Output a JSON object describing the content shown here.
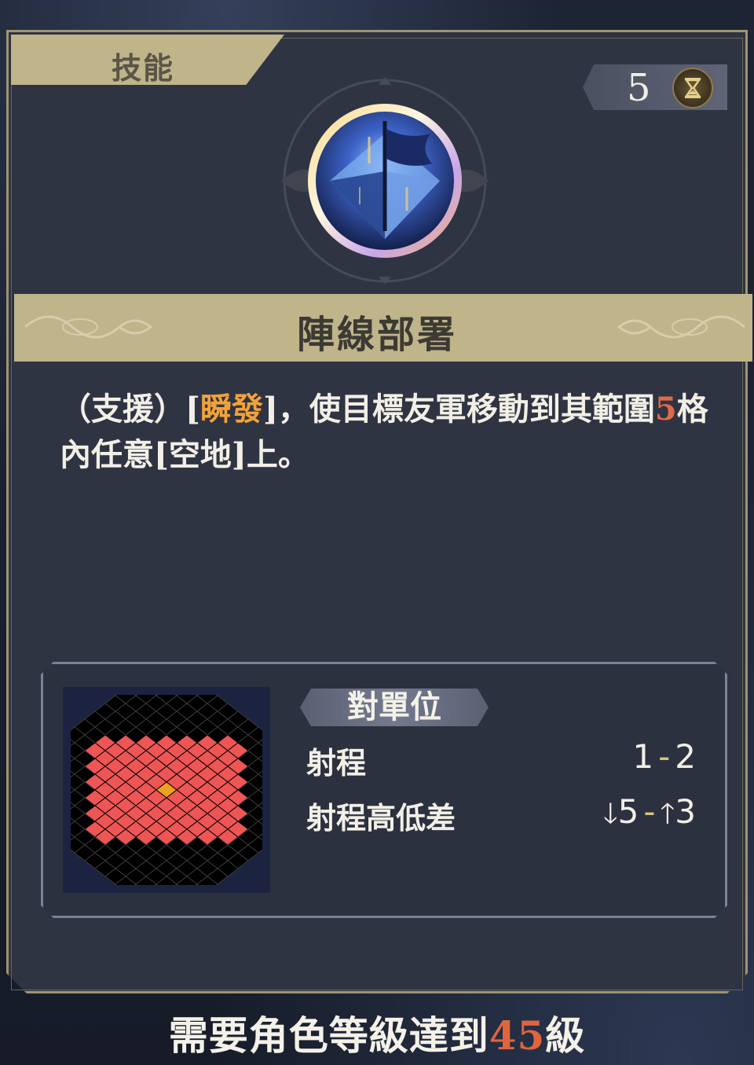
{
  "tab": {
    "label": "技能"
  },
  "cost": {
    "value": "5",
    "icon": "hourglass-icon"
  },
  "skill": {
    "icon": "flag-emblem-icon",
    "name": "陣線部署",
    "description": {
      "part1": "（支援）[",
      "keyword": "瞬發",
      "part2": "]，使目標友軍移動到其範圍",
      "range_number": "5",
      "part3": "格內任意[空地]上。"
    }
  },
  "range_panel": {
    "target_label": "對單位",
    "stats": [
      {
        "label": "射程",
        "min": "1",
        "sep": "-",
        "max": "2"
      },
      {
        "label": "射程高低差",
        "down": "5",
        "sep": "-",
        "up": "3"
      }
    ],
    "grid": {
      "highlight_color": "#ee5555",
      "center_color": "#f0a020"
    }
  },
  "requirement": {
    "prefix": "需要角色等級達到",
    "level": "45",
    "suffix": "級"
  }
}
